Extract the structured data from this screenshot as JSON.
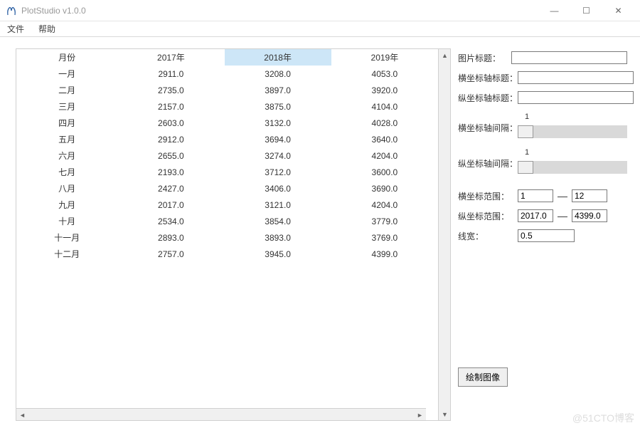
{
  "window": {
    "title": "PlotStudio v1.0.0",
    "minimize": "—",
    "maximize": "☐",
    "close": "✕"
  },
  "menubar": {
    "file": "文件",
    "help": "帮助"
  },
  "table": {
    "headers": [
      "月份",
      "2017年",
      "2018年",
      "2019年"
    ],
    "selected_col": 2,
    "rows": [
      [
        "一月",
        "2911.0",
        "3208.0",
        "4053.0"
      ],
      [
        "二月",
        "2735.0",
        "3897.0",
        "3920.0"
      ],
      [
        "三月",
        "2157.0",
        "3875.0",
        "4104.0"
      ],
      [
        "四月",
        "2603.0",
        "3132.0",
        "4028.0"
      ],
      [
        "五月",
        "2912.0",
        "3694.0",
        "3640.0"
      ],
      [
        "六月",
        "2655.0",
        "3274.0",
        "4204.0"
      ],
      [
        "七月",
        "2193.0",
        "3712.0",
        "3600.0"
      ],
      [
        "八月",
        "2427.0",
        "3406.0",
        "3690.0"
      ],
      [
        "九月",
        "2017.0",
        "3121.0",
        "4204.0"
      ],
      [
        "十月",
        "2534.0",
        "3854.0",
        "3779.0"
      ],
      [
        "十一月",
        "2893.0",
        "3893.0",
        "3769.0"
      ],
      [
        "十二月",
        "2757.0",
        "3945.0",
        "4399.0"
      ]
    ]
  },
  "form": {
    "image_title_label": "图片标题：",
    "image_title": "",
    "x_title_label": "横坐标轴标题：",
    "x_title": "",
    "y_title_label": "纵坐标轴标题：",
    "y_title": "",
    "x_interval_label": "横坐标轴间隔：",
    "x_interval": "1",
    "y_interval_label": "纵坐标轴间隔：",
    "y_interval": "1",
    "x_range_label": "横坐标范围：",
    "x_range_min": "1",
    "x_range_max": "12",
    "y_range_label": "纵坐标范围：",
    "y_range_min": "2017.0",
    "y_range_max": "4399.0",
    "linewidth_label": "线宽：",
    "linewidth": "0.5",
    "range_dash": "—",
    "draw_button": "绘制图像"
  },
  "watermark": "@51CTO博客"
}
